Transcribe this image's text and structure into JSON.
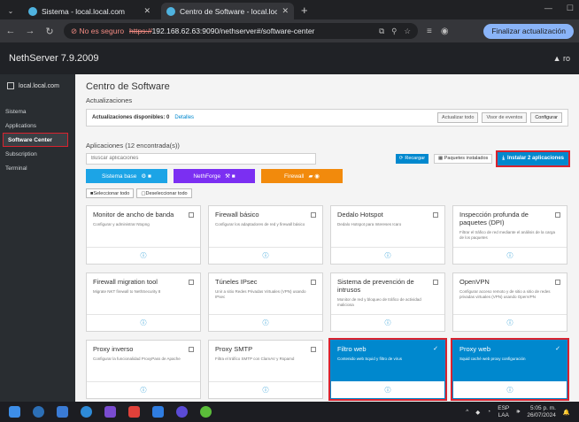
{
  "browser": {
    "tabs": [
      {
        "title": "Sistema - local.local.com",
        "active": false
      },
      {
        "title": "Centro de Software - local.local",
        "active": true
      }
    ],
    "not_secure": "No es seguro",
    "url_scheme": "https://",
    "url_rest": "192.168.62.63:9090/nethserver#/software-center",
    "update_button": "Finalizar actualización"
  },
  "app": {
    "brand": "NethServer 7.9.2009",
    "user": "ro"
  },
  "sidebar": {
    "host": "local.local.com",
    "items": [
      {
        "label": "Sistema",
        "active": false
      },
      {
        "label": "Applications",
        "active": false
      },
      {
        "label": "Software Center",
        "active": true
      },
      {
        "label": "Subscription",
        "active": false
      },
      {
        "label": "Terminal",
        "active": false
      }
    ]
  },
  "main": {
    "title": "Centro de Software",
    "updates_heading": "Actualizaciones",
    "updates_available": "Actualizaciones disponibles: 0",
    "details_link": "Detalles",
    "btn_update_all": "Actualizar todo",
    "btn_view_events": "Visor de eventos",
    "btn_configure": "Configurar",
    "apps_heading": "Aplicaciones (12 encontrada(s))",
    "search_placeholder": "Buscar aplicaciones",
    "btn_refresh": "Recargar",
    "btn_installed": "Paquetes instalados",
    "btn_install": "Instalar 2 aplicaciones",
    "filters": [
      {
        "label": "Sistema base",
        "color": "#1ca4e6"
      },
      {
        "label": "NethForge",
        "color": "#7b2ff2"
      },
      {
        "label": "Firewall",
        "color": "#f28a0c"
      }
    ],
    "btn_select_all": "Seleccionar todo",
    "btn_deselect_all": "Deseleccionar todo",
    "apps": [
      {
        "title": "Monitor de ancho de banda",
        "desc": "Configurar y administrar Ntopng",
        "selected": false
      },
      {
        "title": "Firewall básico",
        "desc": "Configurar los adaptadores de red y firewall básico",
        "selected": false
      },
      {
        "title": "Dedalo Hotspot",
        "desc": "Dedalo Hotspot para Intereses Icaro",
        "selected": false
      },
      {
        "title": "Inspección profunda de paquetes (DPI)",
        "desc": "Filtrar el tráfico de red mediante el análisis de la carga de los paquetes",
        "selected": false
      },
      {
        "title": "Firewall migration tool",
        "desc": "Migrate NKT firewall to NethSecurity 8",
        "selected": false
      },
      {
        "title": "Túneles IPsec",
        "desc": "Unir a sitio Redes Privadas Virtuales (VPN) usando IPsec",
        "selected": false
      },
      {
        "title": "Sistema de prevención de intrusos",
        "desc": "Monitor de red y bloqueo de tráfico de actividad maliciosa",
        "selected": false
      },
      {
        "title": "OpenVPN",
        "desc": "Configurar acceso remoto y de sitio a sitio de redes privadas virtuales (VPN) usando OpenVPN",
        "selected": false
      },
      {
        "title": "Proxy inverso",
        "desc": "Configurar la funcionalidad ProxyPass de Apache",
        "selected": false
      },
      {
        "title": "Proxy SMTP",
        "desc": "Filtra el tráfico SMTP con ClamAV y Rspamd",
        "selected": false
      },
      {
        "title": "Filtro web",
        "desc": "Contenido web Squid y filtro de virus",
        "selected": true
      },
      {
        "title": "Proxy web",
        "desc": "Squid caché web proxy configuración",
        "selected": true
      }
    ]
  },
  "taskbar": {
    "lang_top": "ESP",
    "lang_bottom": "LAA",
    "time": "5:05 p. m.",
    "date": "26/07/2024"
  }
}
